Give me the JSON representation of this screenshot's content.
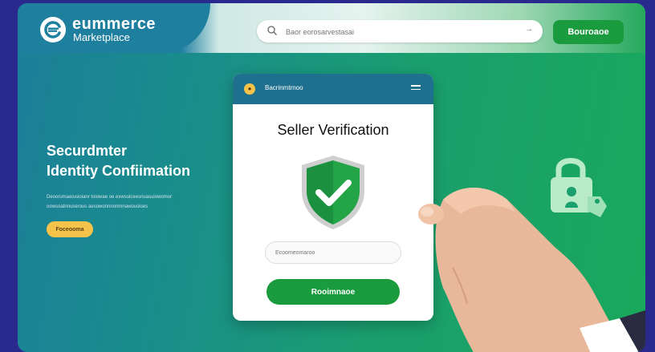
{
  "brand": {
    "title": "eummerce",
    "subtitle": "Marketplace"
  },
  "search": {
    "placeholder": "Baor eorosarvestasai",
    "arrow": "→"
  },
  "header": {
    "button_label": "Bouroaoe"
  },
  "hero": {
    "title_line1": "Securdmter",
    "title_line2": "Identity Confiimation",
    "description": "Deoorumaeiusioianr toiowae oe exwsuiceesnuasuiowomor oowsoatnnuserous aesowonnnonmnawousioes",
    "button_label": "Foceooma"
  },
  "card": {
    "top_title": "Bacrinmtrnoo",
    "title": "Seller Verification",
    "input_placeholder": "Ecoomeomaroo",
    "button_label": "Rooimnaoe"
  },
  "colors": {
    "accent": "#1a9b3e",
    "header_blue": "#1f7f9f",
    "yellow": "#f5c34a",
    "bg": "#2a2a8e"
  },
  "icons": [
    "logo-icon",
    "search-icon",
    "arrow-icon",
    "menu-icon",
    "shield-check-icon",
    "lock-icon",
    "hand"
  ]
}
